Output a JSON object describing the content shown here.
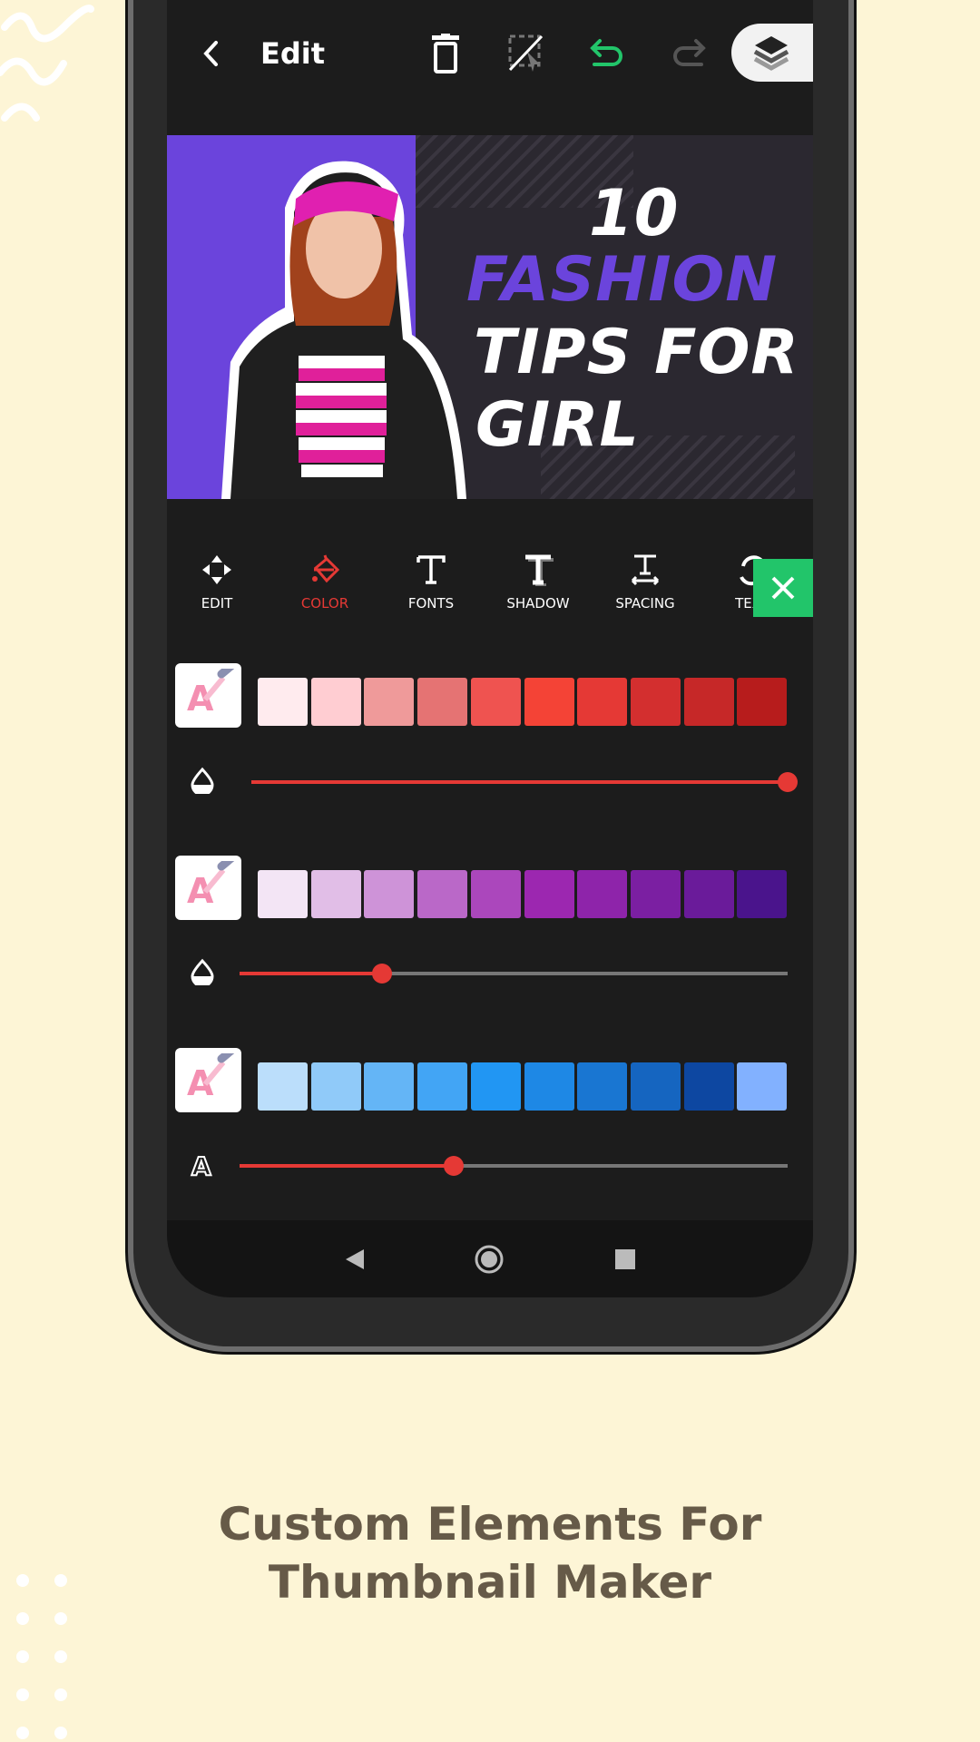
{
  "topbar": {
    "title": "Edit",
    "icons": [
      "back-icon",
      "trash-icon",
      "deselect-icon",
      "undo-icon",
      "redo-icon",
      "layers-icon"
    ],
    "undo_color": "#22c56a"
  },
  "thumbnail": {
    "line1": "10",
    "line2": "FASHION",
    "line3": "TIPS FOR",
    "line4": "GIRL",
    "accent": "#6b44dc"
  },
  "tools": [
    {
      "label": "EDIT",
      "icon": "move-icon"
    },
    {
      "label": "COLOR",
      "icon": "paint-bucket-icon",
      "active": true
    },
    {
      "label": "FONTS",
      "icon": "font-icon"
    },
    {
      "label": "SHADOW",
      "icon": "shadow-icon"
    },
    {
      "label": "SPACING",
      "icon": "spacing-icon"
    },
    {
      "label": "TEXT",
      "icon": "text-3d-icon"
    }
  ],
  "palettes": [
    {
      "colors": [
        "#ffebee",
        "#ffcdd2",
        "#ef9a9a",
        "#e57373",
        "#ef5350",
        "#f44336",
        "#e53935",
        "#d32f2f",
        "#c62828",
        "#b71c1c"
      ],
      "slider_icon": "opacity-icon",
      "slider_value": 1.0
    },
    {
      "colors": [
        "#f3e5f5",
        "#e1bee7",
        "#ce93d8",
        "#ba68c8",
        "#ab47bc",
        "#9c27b0",
        "#8e24aa",
        "#7b1fa2",
        "#6a1b9a",
        "#4a148c"
      ],
      "slider_icon": "opacity-icon",
      "slider_value": 0.26
    },
    {
      "colors": [
        "#bbdefb",
        "#90caf9",
        "#64b5f6",
        "#42a5f5",
        "#2196f3",
        "#1e88e5",
        "#1976d2",
        "#1565c0",
        "#0d47a1",
        "#82b1ff"
      ],
      "slider_icon": "text-outline-icon",
      "slider_value": 0.39
    }
  ],
  "caption": {
    "line1": "Custom Elements For",
    "line2": "Thumbnail Maker"
  }
}
